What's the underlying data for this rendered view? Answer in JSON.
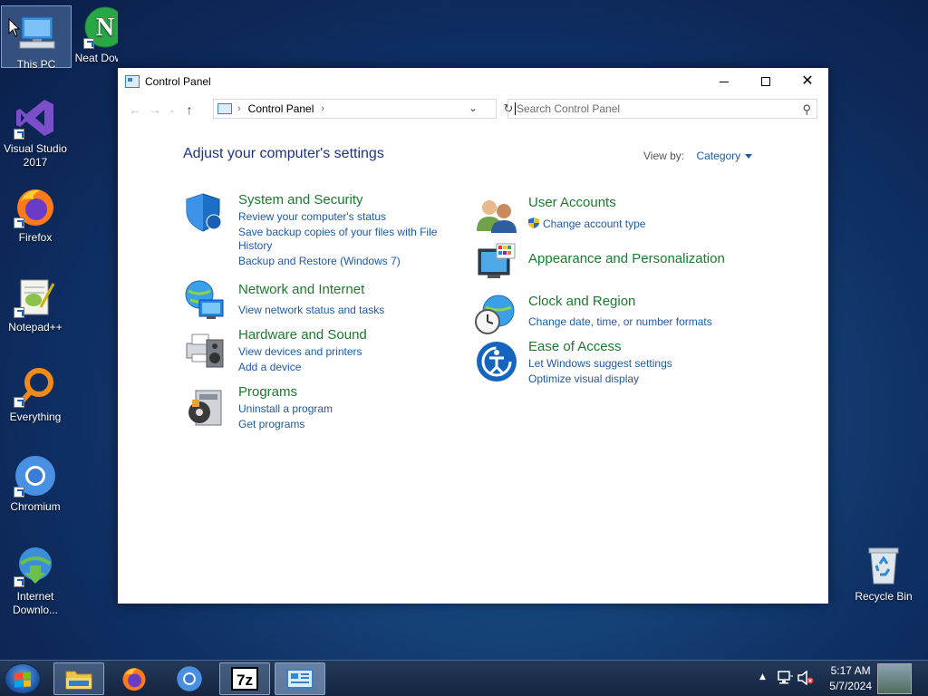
{
  "desktop": {
    "icons": [
      {
        "label": "This PC"
      },
      {
        "label": "Neat Downlo"
      },
      {
        "label": "Visual Studio 2017"
      },
      {
        "label": "Firefox"
      },
      {
        "label": "Notepad++"
      },
      {
        "label": "Everything"
      },
      {
        "label": "Chromium"
      },
      {
        "label": "Internet Downlo..."
      },
      {
        "label": "Recycle Bin"
      }
    ]
  },
  "window": {
    "title": "Control Panel",
    "address": {
      "crumb": "Control Panel"
    },
    "search": {
      "placeholder": "Search Control Panel"
    },
    "heading": "Adjust your computer's settings",
    "view_by": {
      "label": "View by:",
      "value": "Category"
    },
    "categories": {
      "system": {
        "title": "System and Security",
        "links": [
          "Review your computer's status",
          "Save backup copies of your files with File",
          "History",
          "Backup and Restore (Windows 7)"
        ]
      },
      "network": {
        "title": "Network and Internet",
        "links": [
          "View network status and tasks"
        ]
      },
      "hardware": {
        "title": "Hardware and Sound",
        "links": [
          "View devices and printers",
          "Add a device"
        ]
      },
      "programs": {
        "title": "Programs",
        "links": [
          "Uninstall a program",
          "Get programs"
        ]
      },
      "users": {
        "title": "User Accounts",
        "links": [
          "Change account type"
        ]
      },
      "appearance": {
        "title": "Appearance and Personalization",
        "links": []
      },
      "clock": {
        "title": "Clock and Region",
        "links": [
          "Change date, time, or number formats"
        ]
      },
      "ease": {
        "title": "Ease of Access",
        "links": [
          "Let Windows suggest settings",
          "Optimize visual display"
        ]
      }
    }
  },
  "taskbar": {
    "items": [
      "start-button",
      "file-explorer-icon",
      "firefox-icon",
      "chromium-icon",
      "7zip-icon",
      "control-panel-icon"
    ],
    "clock": {
      "time": "5:17 AM",
      "date": "5/7/2024"
    },
    "tray_icons": [
      "show-hidden-icons",
      "network-icon",
      "volume-muted-icon"
    ]
  },
  "colors": {
    "category_title": "#1c7a2e",
    "link": "#1e5aa8",
    "heading": "#1e3287"
  }
}
